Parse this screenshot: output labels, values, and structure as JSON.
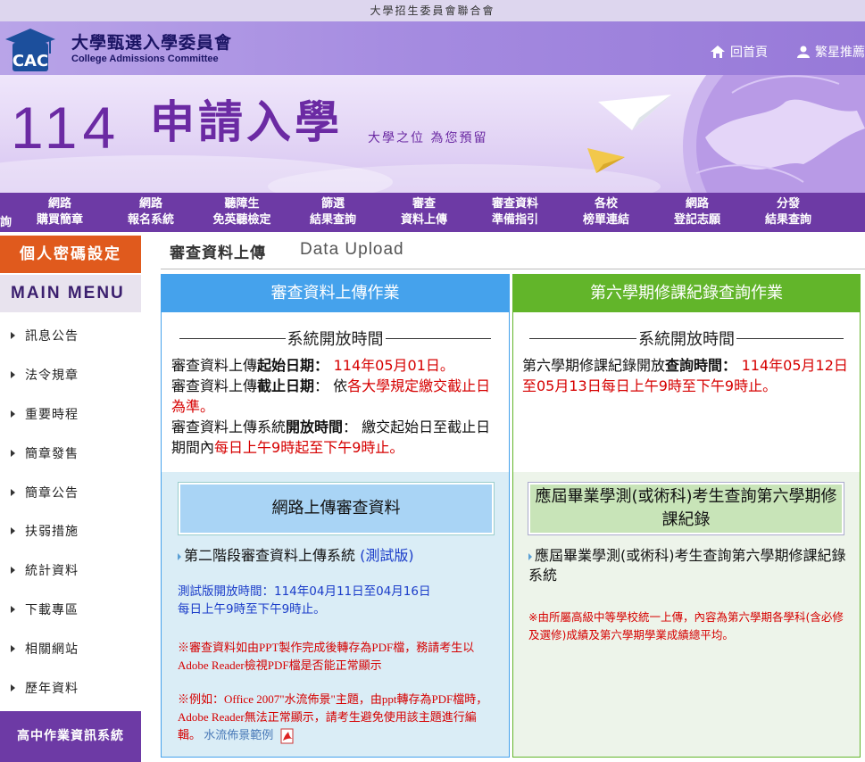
{
  "top_strip": "大學招生委員會聯合會",
  "header": {
    "brand_cn": "大學甄選入學委員會",
    "brand_en": "College Admissions Committee",
    "home_label": "回首頁",
    "lang_label": "繁星推薦"
  },
  "banner": {
    "number": "114",
    "title": "申請入學",
    "slogan": "大學之位 為您預留"
  },
  "nav": {
    "cut_label": "詢",
    "items": [
      {
        "line1": "網路",
        "line2": "購買簡章"
      },
      {
        "line1": "網路",
        "line2": "報名系統"
      },
      {
        "line1": "聽障生",
        "line2": "免英聽檢定"
      },
      {
        "line1": "篩選",
        "line2": "結果查詢"
      },
      {
        "line1": "審查",
        "line2": "資料上傳"
      },
      {
        "line1": "審查資料",
        "line2": "準備指引"
      },
      {
        "line1": "各校",
        "line2": "榜單連結"
      },
      {
        "line1": "網路",
        "line2": "登記志願"
      },
      {
        "line1": "分發",
        "line2": "結果查詢"
      }
    ]
  },
  "sidebar": {
    "password_button": "個人密碼設定",
    "menu_title": "MAIN MENU",
    "items": [
      "訊息公告",
      "法令規章",
      "重要時程",
      "簡章發售",
      "簡章公告",
      "扶弱措施",
      "統計資料",
      "下載專區",
      "相關網站",
      "歷年資料"
    ],
    "hs_system": "高中作業資訊系統"
  },
  "content": {
    "title": "審查資料上傳",
    "title_en": "Data Upload"
  },
  "left_panel": {
    "header": "審查資料上傳作業",
    "section_title": "系統開放時間",
    "l1_a": "審查資料上傳",
    "l1_b": "起始日期",
    "l1_c": "： ",
    "l1_d": "114年05月01日。",
    "l2_a": "審查資料上傳",
    "l2_b": "截止日期",
    "l2_c": "： 依",
    "l2_d": "各大學規定繳交截止日為準。",
    "l3_a": "審查資料上傳系統",
    "l3_b": "開放時間",
    "l3_c": "： 繳交起始日至截止日期間內",
    "l3_d": "每日上午9時起至下午9時止。",
    "button": "網路上傳審查資料",
    "link_text": "第二階段審查資料上傳系統",
    "link_test": "(測試版)",
    "test_period_1": "測試版開放時間：114年04月11日至04月16日",
    "test_period_2": "每日上午9時至下午9時止。",
    "note1": "※審查資料如由PPT製作完成後轉存為PDF檔，務請考生以Adobe Reader檢視PDF檔是否能正常顯示",
    "note2": "※例如：Office 2007\"水流佈景\"主題，由ppt轉存為PDF檔時，Adobe Reader無法正常顯示，請考生避免使用該主題進行編輯。",
    "sample_link": "水流佈景範例"
  },
  "right_panel": {
    "header": "第六學期修課紀錄查詢作業",
    "section_title": "系統開放時間",
    "r1_a": "第六學期修課紀錄開放",
    "r1_b": "查詢時間",
    "r1_c": "： ",
    "r1_d": "114年05月12日至05月13日每日上午9時至下午9時止。",
    "button": "應屆畢業學測(或術科)考生查詢第六學期修課紀錄",
    "link_text": "應屆畢業學測(或術科)考生查詢第六學期修課紀錄系統",
    "note": "※由所屬高級中等學校統一上傳，內容為第六學期各學科(含必修及選修)成績及第六學期學業成績總平均。"
  },
  "colors": {
    "nav_purple": "#6d3aa5",
    "orange": "#e05a1d",
    "blue_head": "#45a2ec",
    "green_head": "#62b52a",
    "red_text": "#d60000"
  }
}
